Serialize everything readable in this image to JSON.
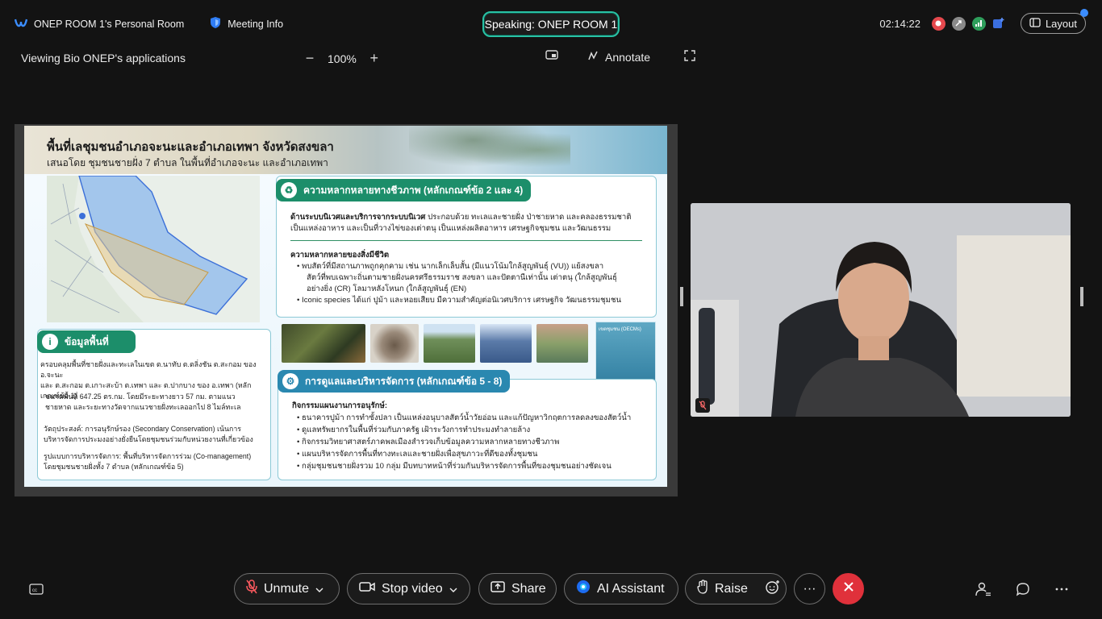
{
  "topbar": {
    "room_name": "ONEP ROOM 1's Personal Room",
    "meeting_info": "Meeting Info",
    "speaking": "Speaking: ONEP ROOM 1",
    "clock": "02:14:22",
    "layout": "Layout"
  },
  "share_toolbar": {
    "viewing": "Viewing Bio ONEP's applications",
    "zoom_minus": "−",
    "zoom_level": "100%",
    "zoom_plus": "+",
    "annotate": "Annotate"
  },
  "slide": {
    "title": "พื้นที่เลชุมชนอำเภอจะนะและอำเภอเทพา จังหวัดสงขลา",
    "subtitle": "เสนอโดย ชุมชนชายฝั่ง 7 ตำบล ในพื้นที่อำเภอจะนะ และอำเภอเทพา",
    "biodiversity": {
      "heading": "ความหลากหลายทางชีวภาพ (หลักเกณฑ์ข้อ 2 และ 4)",
      "ecosystem_label": "ด้านระบบนิเวศและบริการจากระบบนิเวศ",
      "ecosystem_text": " ประกอบด้วย ทะเลและชายฝั่ง ป่าชายหาด และคลองธรรมชาติ",
      "ecosystem_text2": "เป็นแหล่งอาหาร และเป็นที่วางไข่ของเต่าตนุ  เป็นแหล่งผลิตอาหาร เศรษฐกิจชุมชน และวัฒนธรรม",
      "species_heading": "ความหลากหลายของสิ่งมีชีวิต",
      "bullet1a": "• พบสัตว์ที่มีสถานภาพถูกคุกคาม เช่น นากเล็กเล็บสั้น (มีแนวโน้มใกล้สูญพันธุ์ (VU)) แย้สงขลา",
      "bullet1b": "สัตว์ที่พบเฉพาะถิ่นตามชายฝั่งนครศรีธรรมราช สงขลา และปัตตานีเท่านั้น เต่าตนุ (ใกล้สูญพันธุ์",
      "bullet1c": "อย่างยิ่ง (CR) โลมาหลังโหนก (ใกล้สูญพันธุ์ (EN)",
      "bullet2": "• Iconic species ได้แก่ ปูม้า และหอยเสียบ มีความสำคัญต่อนิเวศบริการ เศรษฐกิจ วัฒนธรรมชุมชน"
    },
    "area_info": {
      "heading": "ข้อมูลพื้นที่",
      "line1": "ครอบคลุมพื้นที่ชายฝั่งและทะเลในเขต ต.นาทับ ต.ตลิ่งชัน ต.สะกอม ของ อ.จะนะ",
      "line2": "และ ต.สะกอม ต.เกาะสะบ้า ต.เทพา และ ต.ปากบาง ของ อ.เทพา (หลักเกณฑ์ข้อ 1)",
      "size_line1": "ขนาดพื้นที่ 647.25 ตร.กม. โดยมีระยะทางยาว 57 กม. ตามแนว",
      "size_line2": "ชายหาด และระยะทางวัดจากแนวชายฝั่งทะเลออกไป 8 ไมล์ทะเล",
      "purpose1": "วัตถุประสงค์:  การอนุรักษ์รอง (Secondary Conservation) เน้นการ",
      "purpose2": "บริหารจัดการประมงอย่างยั่งยืนโดยชุมชนร่วมกับหน่วยงานที่เกี่ยวข้อง",
      "mgmt1": "รูปแบบการบริหารจัดการ: พื้นที่บริหารจัดการร่วม (Co-management)",
      "mgmt2": "โดยชุมชนชายฝั่งทั้ง 7 ตำบล (หลักเกณฑ์ข้อ 5)"
    },
    "management": {
      "heading": "การดูแลและบริหารจัดการ (หลักเกณฑ์ข้อ 5 - 8)",
      "activities_heading": "กิจกรรมแผนงานการอนุรักษ์:",
      "items": [
        "• ธนาคารปูม้า การทำซั้งปลา เป็นแหล่งอนุบาลสัตว์น้ำวัยอ่อน และแก้ปัญหาวิกฤตการลดลงของสัตว์น้ำ",
        "• ดูแลทรัพยากรในพื้นที่ร่วมกับภาครัฐ เฝ้าระวังการทำประมงทำลายล้าง",
        "• กิจกรรมวิทยาศาสตร์ภาคพลเมืองสำรวจเก็บข้อมูลความหลากหลายทางชีวภาพ",
        "• แผนบริหารจัดการพื้นที่ทางทะเลและชายฝั่งเพื่อสุขภาวะที่ดีของทั้งชุมชน",
        "• กลุ่มชุมชนชายฝั่งรวม 10 กลุ่ม มีบทบาทหน้าที่ร่วมกันบริหารจัดการพื้นที่ของชุมชนอย่างชัดเจน"
      ]
    },
    "poster_label": "เขตชุมชน (OECMs)"
  },
  "controls": {
    "unmute": "Unmute",
    "stop_video": "Stop video",
    "share": "Share",
    "ai_assistant": "AI Assistant",
    "raise": "Raise",
    "more": "···"
  },
  "colors": {
    "accent_teal": "#29c2a5",
    "green_pill": "#1c8e6a",
    "blue_pill": "#2a88b0",
    "end_red": "#e0313b"
  }
}
